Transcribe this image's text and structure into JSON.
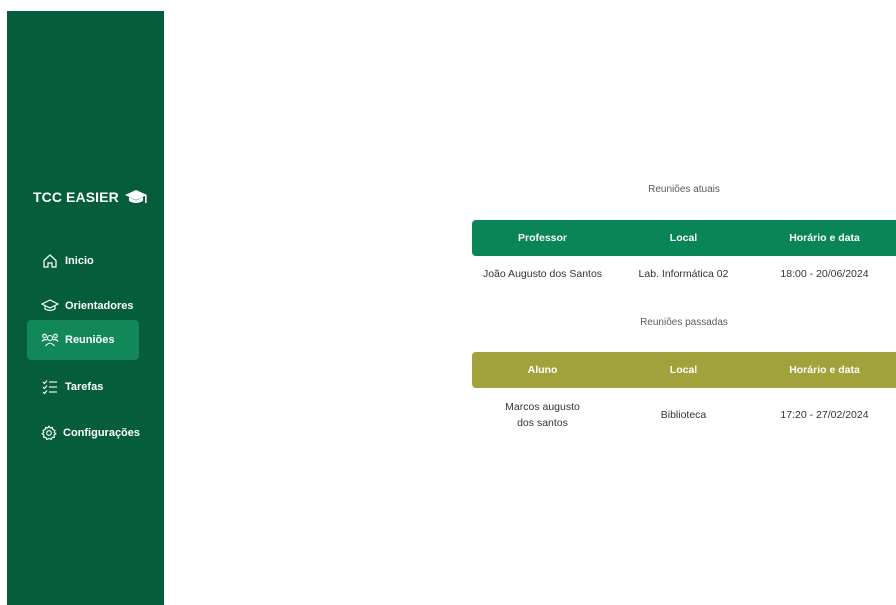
{
  "brand": {
    "name": "TCC EASIER",
    "icon": "graduation-cap-icon"
  },
  "nav": {
    "items": [
      {
        "label": "Inicio",
        "icon": "home-icon"
      },
      {
        "label": "Orientadores",
        "icon": "graduation-cap-icon"
      },
      {
        "label": "Reuniões",
        "icon": "users-icon",
        "active": true
      },
      {
        "label": "Tarefas",
        "icon": "checklist-icon"
      },
      {
        "label": "Configurações",
        "icon": "gear-icon"
      }
    ]
  },
  "current_meetings": {
    "title": "Reuniões atuais",
    "headers": [
      "Professor",
      "Local",
      "Horário e data"
    ],
    "rows": [
      [
        "João Augusto dos Santos",
        "Lab. Informática 02",
        "18:00 - 20/06/2024"
      ]
    ]
  },
  "past_meetings": {
    "title": "Reuniões passadas",
    "headers": [
      "Aluno",
      "Local",
      "Horário e data"
    ],
    "rows": [
      [
        "Marcos augusto dos santos",
        "Biblioteca",
        "17:20 - 27/02/2024"
      ]
    ]
  },
  "colors": {
    "sidebar": "#055d3c",
    "active_item": "#11875a",
    "current_header": "#0a8557",
    "past_header": "#a2a23d"
  }
}
